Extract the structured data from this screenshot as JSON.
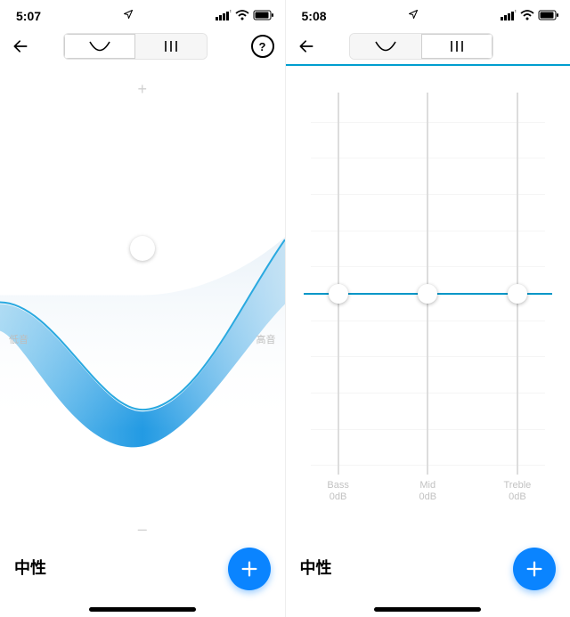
{
  "left": {
    "status_time": "5:07",
    "segmented": {
      "wave_selected": true
    },
    "preset_name": "中性",
    "wave_labels": {
      "low": "低音",
      "high": "高音"
    }
  },
  "right": {
    "status_time": "5:08",
    "segmented": {
      "wave_selected": false
    },
    "preset_name": "中性",
    "sliders": [
      {
        "name": "Bass",
        "value": "0dB"
      },
      {
        "name": "Mid",
        "value": "0dB"
      },
      {
        "name": "Treble",
        "value": "0dB"
      }
    ]
  },
  "icons": {
    "help": "?",
    "plus": "+",
    "minus": "–"
  }
}
